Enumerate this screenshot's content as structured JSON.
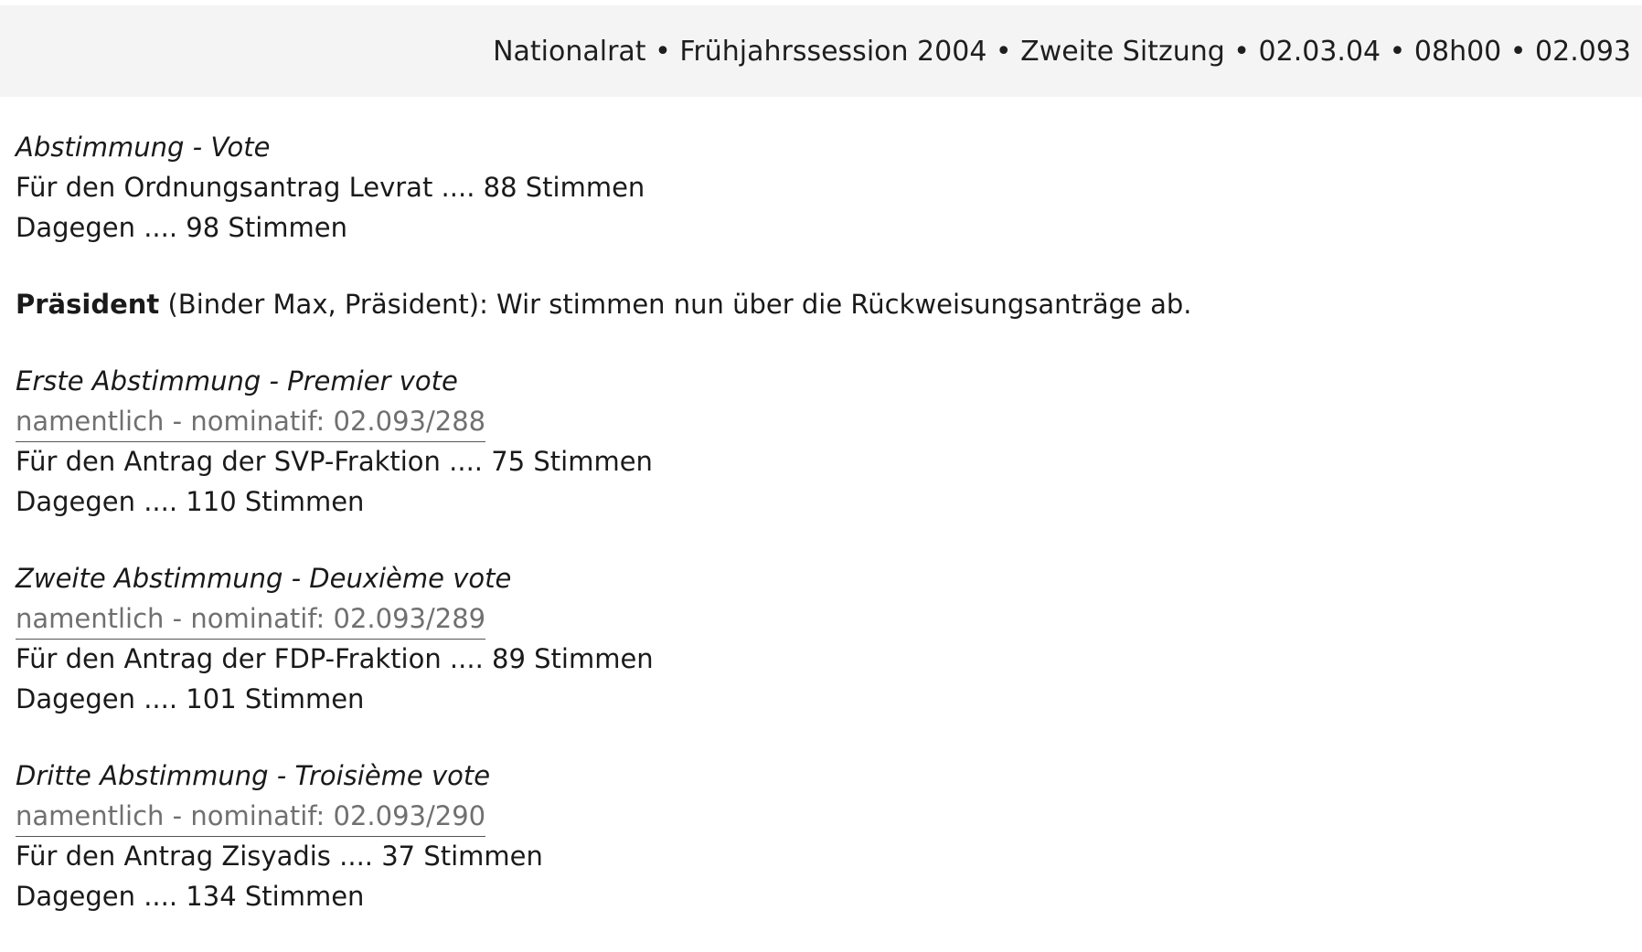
{
  "header": {
    "text": "Nationalrat • Frühjahrssession 2004 • Zweite Sitzung • 02.03.04 • 08h00 • 02.093"
  },
  "vote_intro": {
    "title": "Abstimmung - Vote",
    "for_line": "Für den Ordnungsantrag Levrat .... 88 Stimmen",
    "against_line": "Dagegen .... 98 Stimmen"
  },
  "speech": {
    "speaker": "Präsident",
    "text": " (Binder Max, Präsident): Wir stimmen nun über die Rückweisungsanträge ab."
  },
  "votes": [
    {
      "title": "Erste Abstimmung - Premier vote",
      "ref": "namentlich - nominatif: 02.093/288",
      "for_line": "Für den Antrag der SVP-Fraktion .... 75 Stimmen",
      "against_line": "Dagegen .... 110 Stimmen"
    },
    {
      "title": "Zweite Abstimmung - Deuxième vote",
      "ref": "namentlich - nominatif: 02.093/289",
      "for_line": "Für den Antrag der FDP-Fraktion .... 89 Stimmen",
      "against_line": "Dagegen .... 101 Stimmen"
    },
    {
      "title": "Dritte Abstimmung - Troisième vote",
      "ref": "namentlich - nominatif: 02.093/290",
      "for_line": "Für den Antrag Zisyadis .... 37 Stimmen",
      "against_line": "Dagegen .... 134 Stimmen"
    }
  ]
}
